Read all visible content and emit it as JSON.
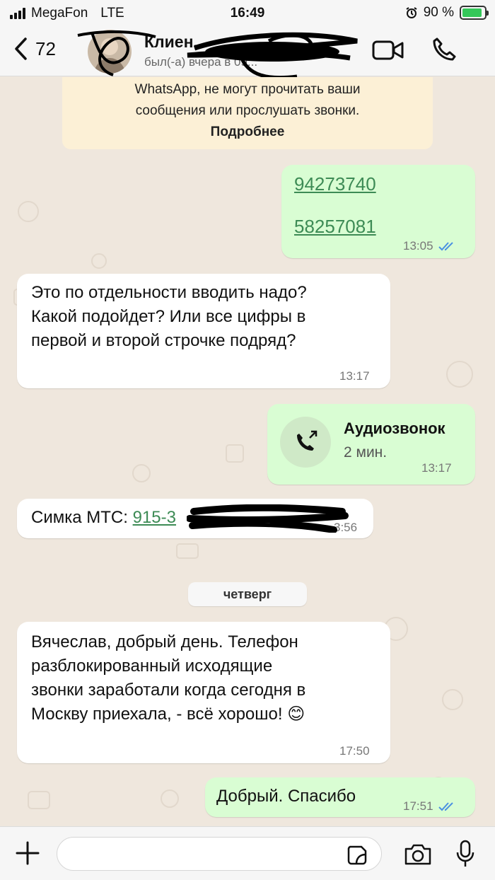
{
  "status_bar": {
    "carrier": "MegaFon",
    "network": "LTE",
    "time": "16:49",
    "battery": "90 %",
    "battery_level": 0.9,
    "battery_color": "#34c759"
  },
  "header": {
    "back_count": "72",
    "contact_name": "Клиен...",
    "contact_status": "был(-а) вчера в 09...",
    "icons": [
      "chevron-left-icon",
      "video-icon",
      "phone-icon"
    ]
  },
  "encryption_notice": {
    "line1": "WhatsApp, не могут прочитать ваши",
    "line2": "сообщения или прослушать звонки.",
    "more_link": "Подробнее"
  },
  "messages": [
    {
      "direction": "out",
      "lines": [
        "94273740",
        "58257081"
      ],
      "time": "13:05",
      "read": true
    },
    {
      "direction": "in",
      "lines": [
        "Это по отдельности вводить надо?",
        "Какой подойдет? Или все цифры в",
        "первой и второй строчке подряд?"
      ],
      "time": "13:17"
    },
    {
      "direction": "out",
      "type": "call",
      "title": "Аудиозвонок",
      "subtitle": "2 мин.",
      "time": "13:17"
    },
    {
      "direction": "in",
      "prefix": "Симка МТС: ",
      "link": "915-3",
      "time": "13:56",
      "time_visible": "3:56"
    },
    {
      "direction": "in",
      "lines": [
        "Вячеслав, добрый день. Телефон",
        "разблокированный исходящие",
        "звонки заработали когда сегодня в",
        "Москву приехала, - всё хорошо! 😊"
      ],
      "time": "17:50"
    },
    {
      "direction": "out",
      "lines": [
        "Добрый. Спасибо"
      ],
      "time": "17:51",
      "read": true
    }
  ],
  "date_separator": "четверг",
  "colors": {
    "chat_background": "#efe7dd",
    "incoming_bubble": "#ffffff",
    "outgoing_bubble": "#d9fdd3",
    "link": "#3d8b55",
    "read_ticks": "#4a90e2"
  }
}
